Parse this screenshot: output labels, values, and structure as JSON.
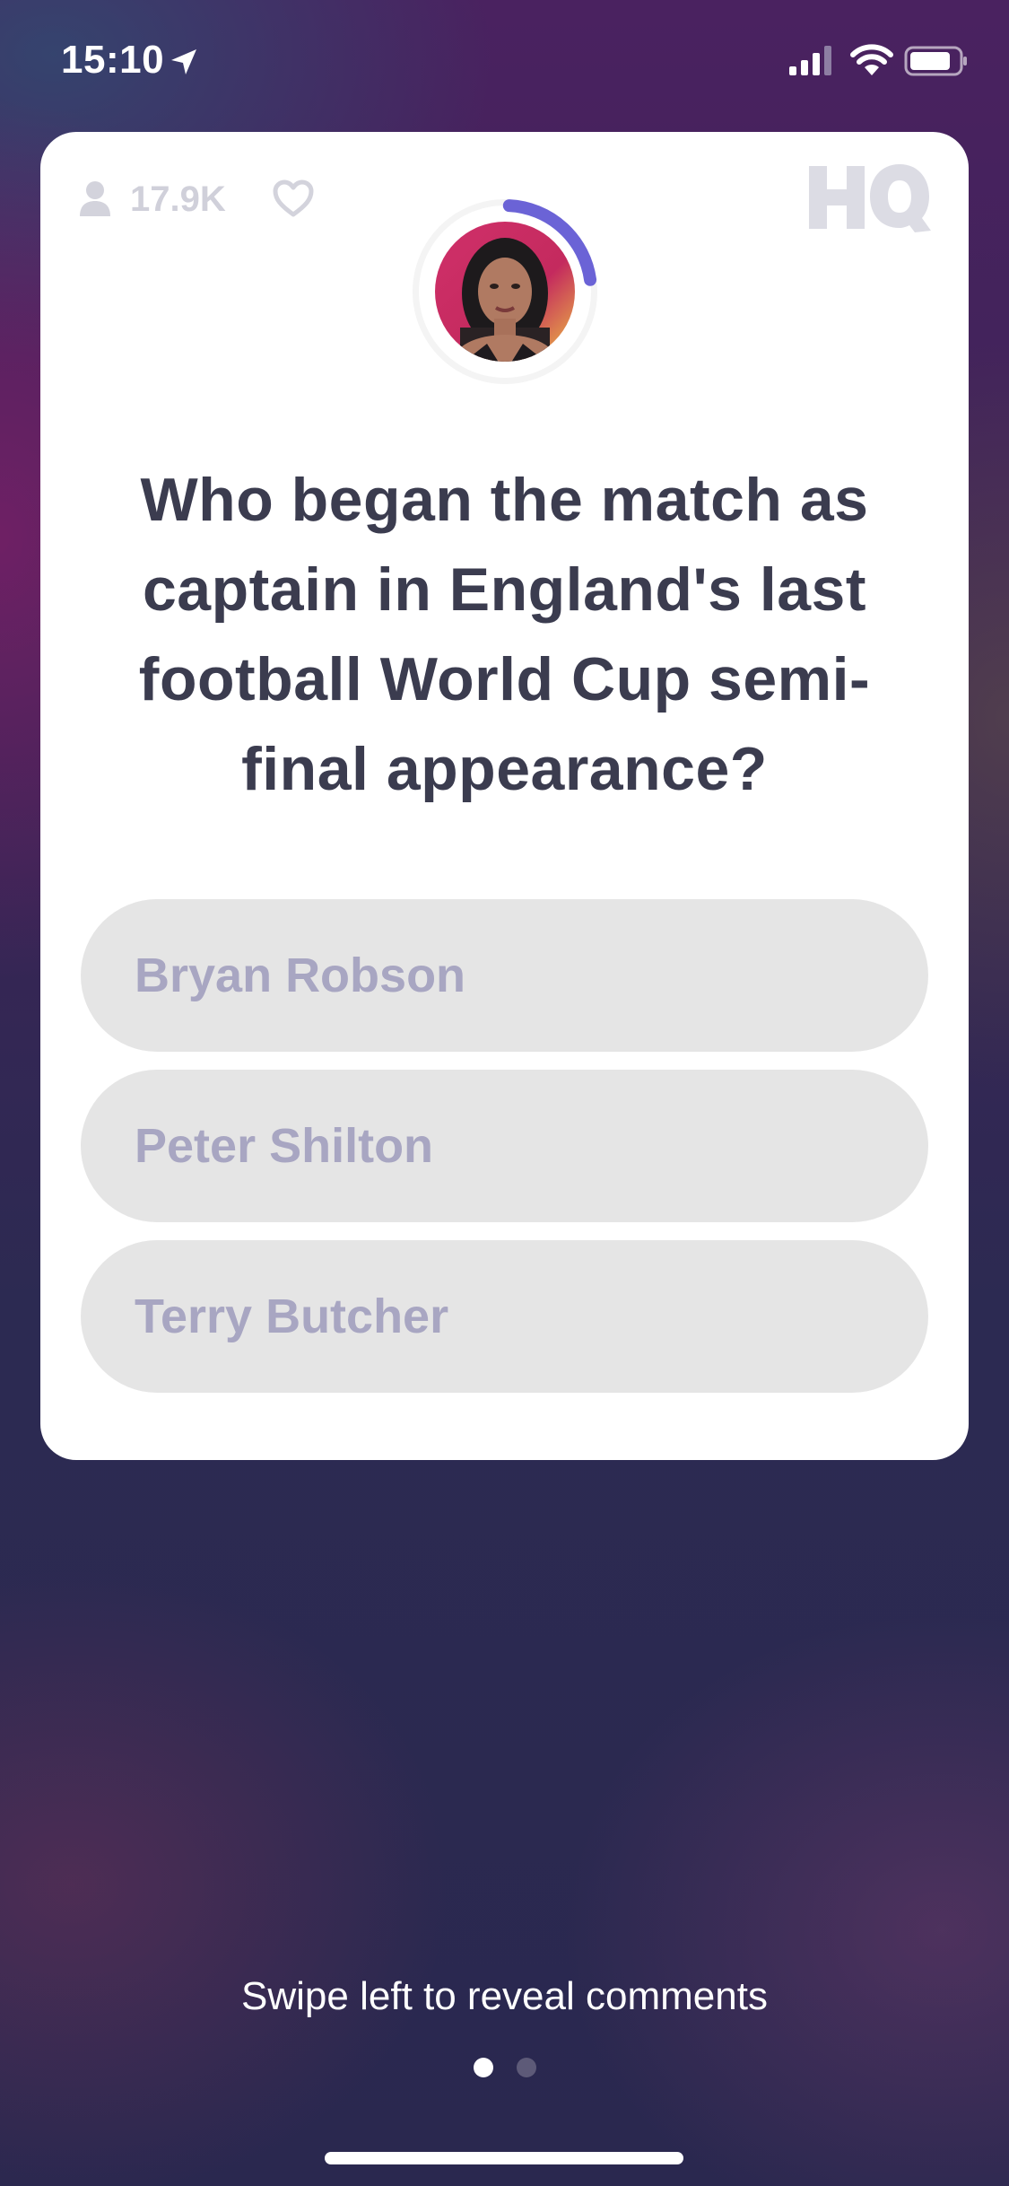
{
  "status_bar": {
    "time": "15:10",
    "icons": [
      "location-arrow-icon",
      "signal-icon",
      "wifi-icon",
      "battery-icon"
    ]
  },
  "card": {
    "viewer_count": "17.9K",
    "icons": [
      "viewer-icon",
      "heart-icon",
      "hq-logo"
    ],
    "question": "Who began the match as captain in England's last football World Cup semi-final appearance?",
    "answers": [
      {
        "label": "Bryan Robson"
      },
      {
        "label": "Peter Shilton"
      },
      {
        "label": "Terry Butcher"
      }
    ],
    "timer_progress": 0.22
  },
  "footer": {
    "swipe_hint": "Swipe left to reveal comments",
    "page_count": 2,
    "active_page": 1
  },
  "colors": {
    "card_bg": "#ffffff",
    "question_text": "#3b3c4f",
    "answer_bg": "#e5e5e5",
    "answer_text": "#a8a6c2",
    "timer_ring": "#6b63d6"
  }
}
